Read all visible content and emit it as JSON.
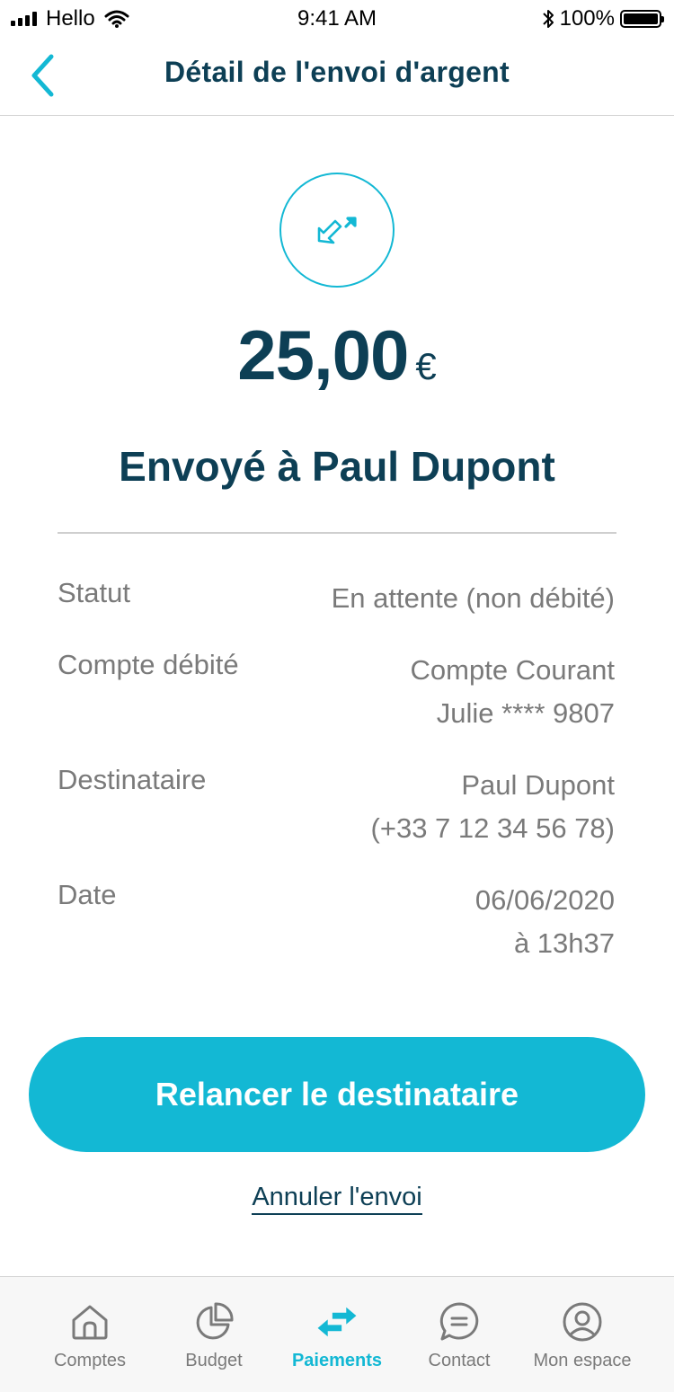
{
  "colors": {
    "accent": "#13b8d4",
    "primary_text": "#0d3f55",
    "secondary_text": "#7a7a7a"
  },
  "status_bar": {
    "carrier": "Hello",
    "time": "9:41 AM",
    "battery": "100%"
  },
  "nav": {
    "title": "Détail de l'envoi d'argent",
    "back_icon": "chevron-left-icon"
  },
  "transfer": {
    "icon": "send-money-icon",
    "amount": "25,00",
    "currency": "€",
    "heading": "Envoyé à Paul Dupont"
  },
  "details": [
    {
      "label": "Statut",
      "lines": [
        "En attente (non débité)"
      ]
    },
    {
      "label": "Compte débité",
      "lines": [
        "Compte Courant",
        "Julie **** 9807"
      ]
    },
    {
      "label": "Destinataire",
      "lines": [
        "Paul Dupont",
        "(+33 7 12 34 56 78)"
      ]
    },
    {
      "label": "Date",
      "lines": [
        "06/06/2020",
        "à 13h37"
      ]
    }
  ],
  "actions": {
    "primary_label": "Relancer le destinataire",
    "cancel_label": "Annuler l'envoi"
  },
  "tabs": [
    {
      "label": "Comptes",
      "icon": "home-icon",
      "active": false
    },
    {
      "label": "Budget",
      "icon": "pie-chart-icon",
      "active": false
    },
    {
      "label": "Paiements",
      "icon": "transfer-arrows-icon",
      "active": true
    },
    {
      "label": "Contact",
      "icon": "chat-icon",
      "active": false
    },
    {
      "label": "Mon espace",
      "icon": "user-icon",
      "active": false
    }
  ]
}
